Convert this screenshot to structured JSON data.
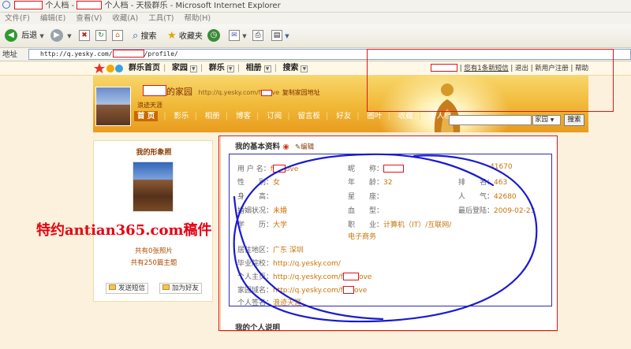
{
  "window": {
    "title_prefix": "个人档 -",
    "title_suffix": "个人档 - 天极群乐 - Microsoft Internet Explorer"
  },
  "menu": [
    "文件(F)",
    "编辑(E)",
    "查看(V)",
    "收藏(A)",
    "工具(T)",
    "帮助(H)"
  ],
  "toolbar": {
    "back": "后退",
    "search": "搜索",
    "favorites": "收藏夹"
  },
  "address": {
    "label": "地址",
    "url_prefix": "http://q.yesky.com/",
    "url_suffix": "/profile/"
  },
  "site_nav": {
    "home": "群乐首页",
    "family": "家园",
    "group": "群乐",
    "album": "相册",
    "search": "搜索"
  },
  "user_links": {
    "messages": "您有1条新短信",
    "logout": "退出",
    "register": "新用户注册",
    "help": "帮助"
  },
  "banner": {
    "title": "的家园",
    "url": "http://q.yesky.com/f",
    "url_tail": "ve",
    "copy_link": "复制家园地址",
    "subtitle": "浪迹天涯",
    "tabs": [
      "首 页",
      "影乐",
      "相册",
      "博客",
      "订阅",
      "留言板",
      "好友",
      "圈叶",
      "收藏",
      "个人档"
    ]
  },
  "search": {
    "select_value": "家园",
    "button": "搜索"
  },
  "left": {
    "heading": "我的形象照",
    "photos": "共有0张照片",
    "topics": "共有250篇主题",
    "send_msg": "发送短信",
    "add_friend": "加为好友"
  },
  "profile": {
    "heading": "我的基本资料",
    "edit": "编辑",
    "username_label": "用 户 名：",
    "username_a": "f",
    "username_b": "ove",
    "nickname_label": "昵　　称：",
    "id_value": "41670",
    "gender_label": "性　　别：",
    "gender": "女",
    "age_label": "年　　龄：",
    "age": "32",
    "rank_label": "排　　名：",
    "rank": "463",
    "height_label": "身　　高：",
    "constellation_label": "星　　座：",
    "popularity_label": "人　　气：",
    "popularity": "42680",
    "marital_label": "婚姻状况：",
    "marital": "未婚",
    "blood_label": "血　　型：",
    "last_login_label": "最后登陆：",
    "last_login": "2009-02-23",
    "education_label": "学　　历：",
    "education": "大学",
    "job_label": "职　　业：",
    "job": "计算机（IT）/互联网/",
    "job_line2": "电子商务",
    "location_label": "居住地区：",
    "location": "广东  深圳",
    "school_label": "毕业院校：",
    "school": "http://q.yesky.com/",
    "homepage_label": "个人主页：",
    "homepage_a": "http://q.yesky.com/f",
    "homepage_b": "ove",
    "domain_label": "家园域名：",
    "domain_a": "http://q.yesky.com/f",
    "domain_b": "ove",
    "sign_label": "个人签名：",
    "sign": "浪迹天涯",
    "about_heading": "我的个人说明"
  },
  "watermark": "特约antian365.com稿件",
  "colors": {
    "accent": "#c8740a",
    "annotation_red": "#e2141c",
    "scribble_blue": "#1a1ad0",
    "banner": "#f0b735"
  }
}
